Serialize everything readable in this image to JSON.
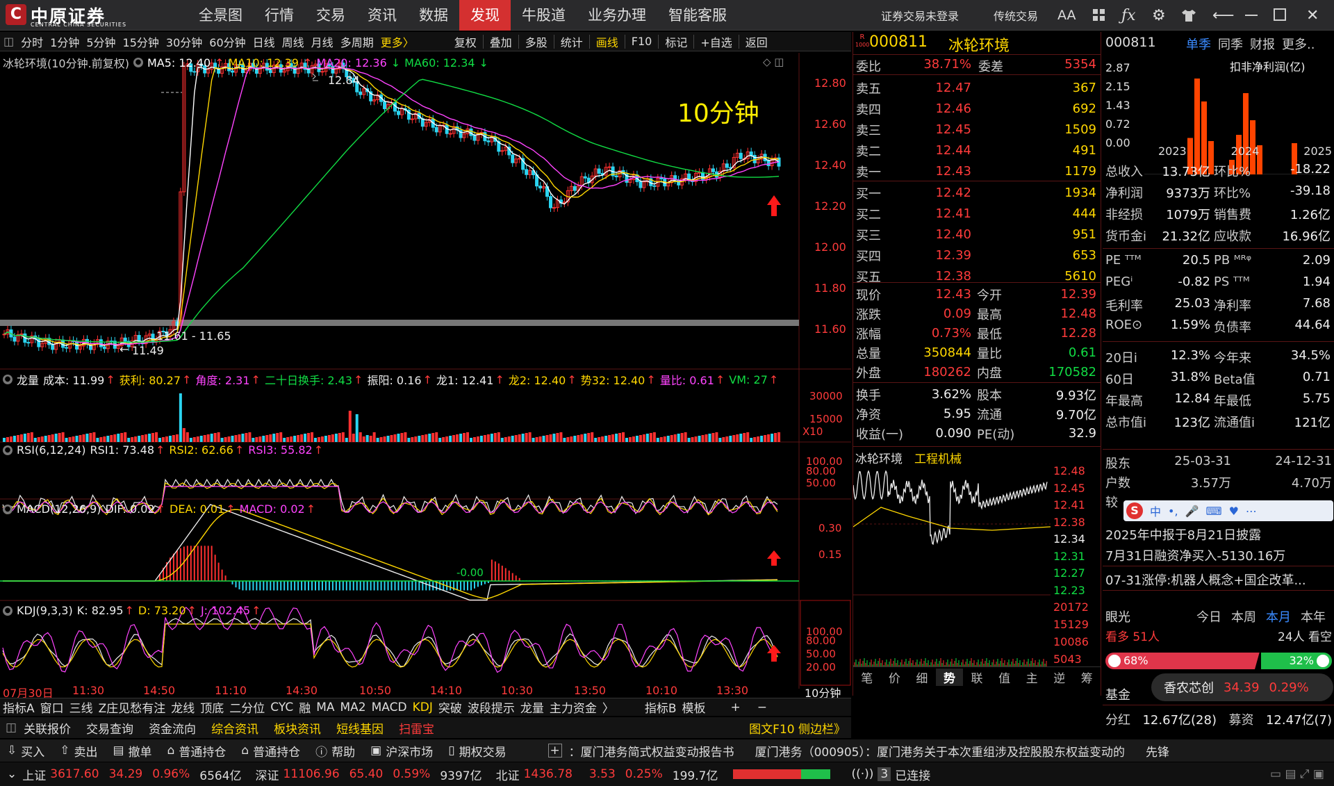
{
  "header": {
    "brand": "中原证券",
    "brand_en": "CENTRAL CHINA SECURITIES",
    "menu": [
      "全景图",
      "行情",
      "交易",
      "资讯",
      "数据",
      "发现",
      "牛股道",
      "业务办理",
      "智能客服"
    ],
    "login": "证券交易未登录",
    "classic": "传统交易",
    "font_icon": "AA"
  },
  "toolbar": {
    "periods": [
      "分时",
      "1分钟",
      "5分钟",
      "15分钟",
      "30分钟",
      "60分钟",
      "日线",
      "周线",
      "月线",
      "多周期"
    ],
    "more": "更多〉",
    "tools": [
      "复权",
      "叠加",
      "多股",
      "统计",
      "画线",
      "F10",
      "标记",
      "+自选",
      "返回"
    ]
  },
  "chart": {
    "title": "冰轮环境(10分钟.前复权)",
    "ma": [
      {
        "t": "MA5: 12.40",
        "c": "#ffffff"
      },
      {
        "t": "MA10: 12.39",
        "c": "#ffd700"
      },
      {
        "t": "MA20: 12.36",
        "c": "#ff44ff"
      },
      {
        "t": "MA60: 12.34",
        "c": "#11dd44"
      }
    ],
    "period_label": "10分钟",
    "high_label": "12.84",
    "low_label": "11.49",
    "range_label": "11.61 - 11.65",
    "y_ticks": [
      "12.80",
      "12.60",
      "12.40",
      "12.20",
      "12.00",
      "11.80",
      "11.60"
    ],
    "vol_ticks": [
      "30000",
      "15000",
      "X10"
    ],
    "rsi_ticks": [
      "100.00",
      "80.00",
      "50.00"
    ],
    "macd_ticks": [
      "0.30",
      "0.15"
    ],
    "kdj_ticks": [
      "100.00",
      "80.00",
      "50.00",
      "20.00"
    ],
    "macd_zero": "-0.00",
    "x_ticks": [
      "07月30日",
      "11:30",
      "14:50",
      "11:10",
      "14:30",
      "10:50",
      "14:10",
      "10:30",
      "13:50",
      "10:10",
      "13:30"
    ],
    "period_box": "10分钟",
    "ind_vol": [
      {
        "t": "龙量",
        "c": "#eeeeee"
      },
      {
        "t": "成本: 11.99",
        "c": "#eeeeee"
      },
      {
        "t": "获利: 80.27",
        "c": "#ffd700"
      },
      {
        "t": "角度: 2.31",
        "c": "#ff44ff"
      },
      {
        "t": "二十日换手: 2.43",
        "c": "#11dd44"
      },
      {
        "t": "振阳: 0.16",
        "c": "#eeeeee"
      },
      {
        "t": "龙1: 12.41",
        "c": "#eeeeee"
      },
      {
        "t": "龙2: 12.40",
        "c": "#ffd700"
      },
      {
        "t": "势32: 12.40",
        "c": "#ffd700"
      },
      {
        "t": "量比: 0.61",
        "c": "#ff44ff"
      },
      {
        "t": "VM: 27",
        "c": "#11dd44"
      }
    ],
    "ind_rsi": [
      {
        "t": "RSI(6,12,24)",
        "c": "#eeeeee"
      },
      {
        "t": "RSI1: 73.48",
        "c": "#eeeeee"
      },
      {
        "t": "RSI2: 62.66",
        "c": "#ffd700"
      },
      {
        "t": "RSI3: 55.82",
        "c": "#ff44ff"
      }
    ],
    "ind_macd": [
      {
        "t": "MACD(12,26,9)",
        "c": "#eeeeee"
      },
      {
        "t": "DIF: 0.02",
        "c": "#eeeeee"
      },
      {
        "t": "DEA: 0.01",
        "c": "#ffd700"
      },
      {
        "t": "MACD: 0.02",
        "c": "#ff44ff"
      }
    ],
    "ind_kdj": [
      {
        "t": "KDJ(9,3,3)",
        "c": "#eeeeee"
      },
      {
        "t": "K: 82.95",
        "c": "#eeeeee"
      },
      {
        "t": "D: 73.20",
        "c": "#ffd700"
      },
      {
        "t": "J: 102.45",
        "c": "#ff44ff"
      }
    ]
  },
  "quote": {
    "code": "000811",
    "name": "冰轮环境",
    "r_badge": "R",
    "r_sub": "1000",
    "wb": "委比",
    "wb_v": "38.71%",
    "wc": "委差",
    "wc_v": "5354",
    "sells": [
      [
        "卖五",
        "12.47",
        "367"
      ],
      [
        "卖四",
        "12.46",
        "692"
      ],
      [
        "卖三",
        "12.45",
        "1509"
      ],
      [
        "卖二",
        "12.44",
        "491"
      ],
      [
        "卖一",
        "12.43",
        "1179"
      ]
    ],
    "buys": [
      [
        "买一",
        "12.42",
        "1934"
      ],
      [
        "买二",
        "12.41",
        "444"
      ],
      [
        "买三",
        "12.40",
        "951"
      ],
      [
        "买四",
        "12.39",
        "653"
      ],
      [
        "买五",
        "12.38",
        "5610"
      ]
    ],
    "stats": [
      [
        "现价",
        "12.43",
        "今开",
        "12.39"
      ],
      [
        "涨跌",
        "0.09",
        "最高",
        "12.48"
      ],
      [
        "涨幅",
        "0.73%",
        "最低",
        "12.28"
      ],
      [
        "总量",
        "350844",
        "量比",
        "0.61"
      ],
      [
        "外盘",
        "180262",
        "内盘",
        "170582"
      ]
    ],
    "stats2": [
      [
        "换手",
        "3.62%",
        "股本",
        "9.93亿"
      ],
      [
        "净资",
        "5.95",
        "流通",
        "9.70亿"
      ],
      [
        "收益(一)",
        "0.090",
        "PE(动)",
        "32.9"
      ]
    ],
    "mini_title": "冰轮环境",
    "mini_sector": "工程机械",
    "mini_price_ticks": [
      "12.48",
      "12.45",
      "12.41",
      "12.38",
      "12.34",
      "12.31",
      "12.27",
      "12.23"
    ],
    "mini_vol_ticks": [
      "20172",
      "15129",
      "10086",
      "5043"
    ],
    "tabs": [
      "笔",
      "价",
      "细",
      "势",
      "联",
      "值",
      "主",
      "逆",
      "筹"
    ],
    "tab_active": "势"
  },
  "fin": {
    "code": "000811",
    "tabs": [
      "单季",
      "同季",
      "财报",
      "更多.."
    ],
    "bar_title": "扣非净利润(亿)",
    "y": [
      "2.87",
      "2.15",
      "1.43",
      "0.72",
      "0.00"
    ],
    "years": [
      "2023",
      "2024",
      "2025"
    ],
    "rows": [
      [
        "总收入",
        "13.73亿",
        "环比%",
        "-18.22"
      ],
      [
        "净利润",
        "9373万",
        "环比%",
        "-39.18"
      ],
      [
        "非经损",
        "1079万",
        "销售费",
        "1.26亿"
      ],
      [
        "货币金i",
        "21.32亿",
        "应收款",
        "16.96亿"
      ]
    ],
    "rows2": [
      [
        "PE ᵀᵀᴹ",
        "20.5",
        "PB ᴹᴿᵠ",
        "2.09"
      ],
      [
        "PEGⁱ",
        "-0.82",
        "PS ᵀᵀᴹ",
        "1.94"
      ],
      [
        "毛利率",
        "25.03",
        "净利率",
        "7.68"
      ],
      [
        "ROE⊙",
        "1.59%",
        "负债率",
        "44.64"
      ]
    ],
    "rows3": [
      [
        "20日i",
        "12.3%",
        "今年来",
        "34.5%"
      ],
      [
        "60日",
        "31.8%",
        "Beta值",
        "0.71"
      ],
      [
        "年最高",
        "12.84",
        "年最低",
        "5.75"
      ],
      [
        "总市值i",
        "123亿",
        "流通值i",
        "121亿"
      ]
    ],
    "holders": [
      "股东",
      "25-03-31",
      "24-12-31"
    ],
    "holders2": [
      "户数",
      "3.57万",
      "4.70万"
    ],
    "holders3": "较",
    "news": [
      "2025年中报于8月21日披露",
      "7月31日融资净买入-5130.16万",
      "07-31涨停:机器人概念+国企改革..."
    ],
    "view": "眼光",
    "periods": [
      "今日",
      "本周",
      "本月",
      "本年"
    ],
    "period_active": "本月",
    "bull": "看多 51人",
    "bear": "24人 看空",
    "bull_pct": "68%",
    "bear_pct": "32%",
    "fund": "基金",
    "fund_name": "香农芯创",
    "fund_price": "34.39",
    "fund_pct": "0.29%",
    "div": "分红",
    "div_v": "12.67亿(28)",
    "raise": "募资",
    "raise_v": "12.47亿(7)"
  },
  "bottom": {
    "tabs": [
      "指标A",
      "窗口",
      "三线",
      "Z庄见愁有注",
      "龙线",
      "顶底",
      "二分位",
      "CYC",
      "融",
      "MA",
      "MA2",
      "MACD",
      "KDJ",
      "突破",
      "波段提示",
      "龙量",
      "主力资金",
      "〉"
    ],
    "tabs_r": [
      "指标B",
      "模板"
    ],
    "links": [
      "关联报价",
      "交易查询",
      "资金流向",
      "综合资讯",
      "板块资讯",
      "短线基因",
      "扫雷宝"
    ],
    "f10": "图文F10 侧边栏》",
    "actions": [
      "买入",
      "卖出",
      "撤单",
      "普通持仓",
      "普通持仓",
      "帮助",
      "沪深市场",
      "期权交易"
    ],
    "ticker1": "：厦门港务简式权益变动报告书",
    "ticker2": "厦门港务（000905）：厦门港务关于本次重组涉及控股股东权益变动的",
    "ticker3": "先锋"
  },
  "status": {
    "sh": "上证",
    "sh_v": "3617.60",
    "sh_c": "34.29",
    "sh_p": "0.96%",
    "sh_a": "6564亿",
    "sz": "深证",
    "sz_v": "11106.96",
    "sz_c": "65.40",
    "sz_p": "0.59%",
    "sz_a": "9397亿",
    "bz": "北证",
    "bz_v": "1436.78",
    "bz_c": "3.53",
    "bz_p": "0.25%",
    "bz_a": "199.7亿",
    "conn_n": "3",
    "conn": "已连接"
  }
}
